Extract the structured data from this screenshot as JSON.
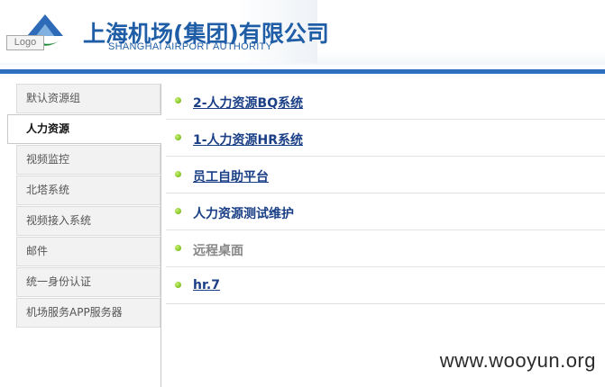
{
  "header": {
    "company_cn": "上海机场(集团)有限公司",
    "company_en": "SHANGHAI AIRPORT AUTHORITY",
    "logo_button": "Logo",
    "brand_color": "#1f5ea6",
    "bar_color": "#2f6fc0"
  },
  "sidebar": {
    "items": [
      {
        "label": "默认资源组",
        "active": false
      },
      {
        "label": "人力资源",
        "active": true
      },
      {
        "label": "视频监控",
        "active": false
      },
      {
        "label": "北塔系统",
        "active": false
      },
      {
        "label": "视频接入系统",
        "active": false
      },
      {
        "label": "邮件",
        "active": false
      },
      {
        "label": "统一身份认证",
        "active": false
      },
      {
        "label": "机场服务APP服务器",
        "active": false
      }
    ]
  },
  "main": {
    "links": [
      {
        "label": "2-人力资源BQ系统",
        "enabled": true
      },
      {
        "label": "1-人力资源HR系统",
        "enabled": true
      },
      {
        "label": "员工自助平台",
        "enabled": true
      },
      {
        "label": "人力资源测试维护",
        "enabled": true
      },
      {
        "label": "远程桌面",
        "enabled": false
      },
      {
        "label": "hr.7",
        "enabled": true
      }
    ]
  },
  "watermark": "www.wooyun.org"
}
